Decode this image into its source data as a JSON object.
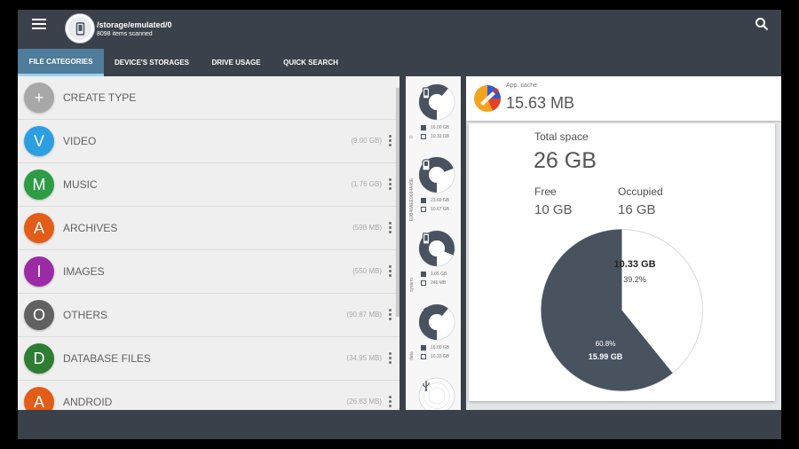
{
  "header": {
    "path": "/storage/emulated/0",
    "items_scanned": "8098 items scanned"
  },
  "tabs": [
    {
      "label": "FILE CATEGORIES",
      "active": true
    },
    {
      "label": "DEVICE'S STORAGES",
      "active": false
    },
    {
      "label": "DRIVE USAGE",
      "active": false
    },
    {
      "label": "QUICK SEARCH",
      "active": false
    }
  ],
  "categories": [
    {
      "letter": "+",
      "name": "CREATE TYPE",
      "size": "",
      "color": "#a8a8a8"
    },
    {
      "letter": "V",
      "name": "VIDEO",
      "size": "(9.00 GB)",
      "color": "#2b9fe2"
    },
    {
      "letter": "M",
      "name": "MUSIC",
      "size": "(1.76 GB)",
      "color": "#2e9b45"
    },
    {
      "letter": "A",
      "name": "ARCHIVES",
      "size": "(598 MB)",
      "color": "#e35d18"
    },
    {
      "letter": "I",
      "name": "IMAGES",
      "size": "(550 MB)",
      "color": "#9b2ba5"
    },
    {
      "letter": "O",
      "name": "OTHERS",
      "size": "(90.87 MB)",
      "color": "#616161"
    },
    {
      "letter": "D",
      "name": "DATABASE FILES",
      "size": "(34.95 MB)",
      "color": "#2d7d32"
    },
    {
      "letter": "A",
      "name": "ANDROID",
      "size": "(26.83 MB)",
      "color": "#e35d18"
    }
  ],
  "storages": [
    {
      "label": "0",
      "icon": "phone-icon",
      "used": "16.00 GB",
      "free": "10.33 GB",
      "fraction_used": 0.61
    },
    {
      "label": "E0B46AEE9664A45E",
      "icon": "sd-card-icon",
      "used": "23.69 GB",
      "free": "10.67 GB",
      "fraction_used": 0.69
    },
    {
      "label": "system",
      "icon": "phone-icon",
      "used": "1.05 GB",
      "free": "246 MB",
      "fraction_used": 0.81
    },
    {
      "label": "data",
      "icon": "android-icon",
      "used": "16.00 GB",
      "free": "10.33 GB",
      "fraction_used": 0.61
    },
    {
      "label": "",
      "icon": "usb-icon",
      "used": "",
      "free": "",
      "fraction_used": 0.0
    }
  ],
  "app_cache": {
    "label": "App. cache",
    "value": "15.63 MB"
  },
  "space": {
    "title": "Total space",
    "total": "26 GB",
    "free_label": "Free",
    "free": "10 GB",
    "occupied_label": "Occupied",
    "occupied": "16 GB"
  },
  "pie": {
    "free_value": "10.33 GB",
    "free_percent": "39.2%",
    "occupied_value": "15.99 GB",
    "occupied_percent": "60.8%",
    "free_fraction": 0.392,
    "occupied_color": "#48535f",
    "free_color": "#ffffff"
  },
  "colors": {
    "app_bar": "#3b414a",
    "active_tab": "#4e7c9a",
    "active_tab_indicator": "#9fd2ec"
  }
}
